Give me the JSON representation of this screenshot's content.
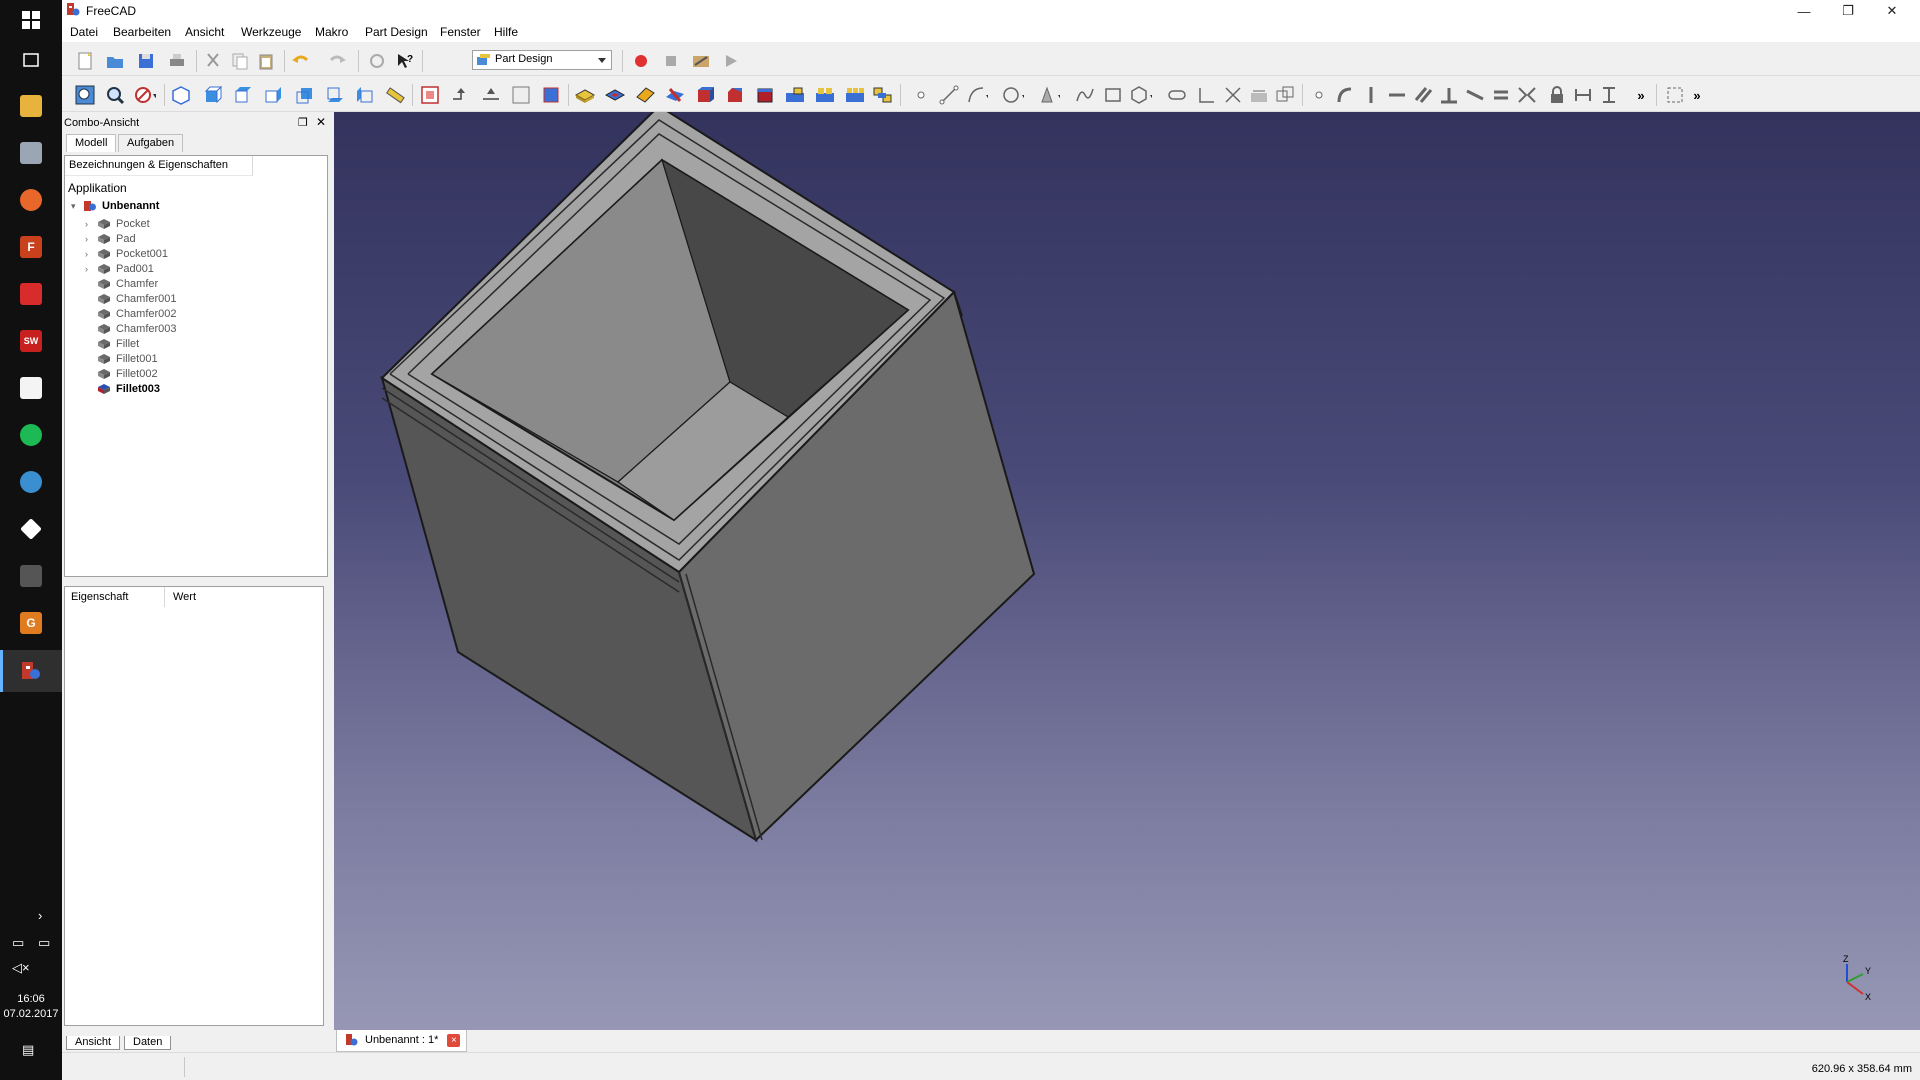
{
  "window": {
    "title": "FreeCAD",
    "accent": "#c0392b"
  },
  "menu": [
    "Datei",
    "Bearbeiten",
    "Ansicht",
    "Werkzeuge",
    "Makro",
    "Part Design",
    "Fenster",
    "Hilfe"
  ],
  "toolbar": {
    "workbench_selected": "Part Design",
    "overflow_label": "»"
  },
  "combo": {
    "title": "Combo-Ansicht",
    "tabs": [
      "Modell",
      "Aufgaben"
    ],
    "tree_header": "Bezeichnungen & Eigenschaften",
    "tree_root": "Applikation",
    "document": "Unbenannt",
    "items": [
      {
        "label": "Pocket",
        "expandable": true
      },
      {
        "label": "Pad",
        "expandable": true
      },
      {
        "label": "Pocket001",
        "expandable": true
      },
      {
        "label": "Pad001",
        "expandable": true
      },
      {
        "label": "Chamfer",
        "expandable": false
      },
      {
        "label": "Chamfer001",
        "expandable": false
      },
      {
        "label": "Chamfer002",
        "expandable": false
      },
      {
        "label": "Chamfer003",
        "expandable": false
      },
      {
        "label": "Fillet",
        "expandable": false
      },
      {
        "label": "Fillet001",
        "expandable": false
      },
      {
        "label": "Fillet002",
        "expandable": false
      },
      {
        "label": "Fillet003",
        "expandable": false,
        "active": true
      }
    ],
    "prop_columns": [
      "Eigenschaft",
      "Wert"
    ],
    "bottom_tabs": [
      "Ansicht",
      "Daten"
    ]
  },
  "document_tab": {
    "label": "Unbenannt : 1*",
    "close": "×"
  },
  "status": {
    "dimensions": "620.96 x 358.64 mm"
  },
  "axis": {
    "x": "X",
    "y": "Y",
    "z": "Z"
  },
  "taskbar": {
    "time": "16:06",
    "date": "07.02.2017",
    "sw_tile": "SW"
  }
}
